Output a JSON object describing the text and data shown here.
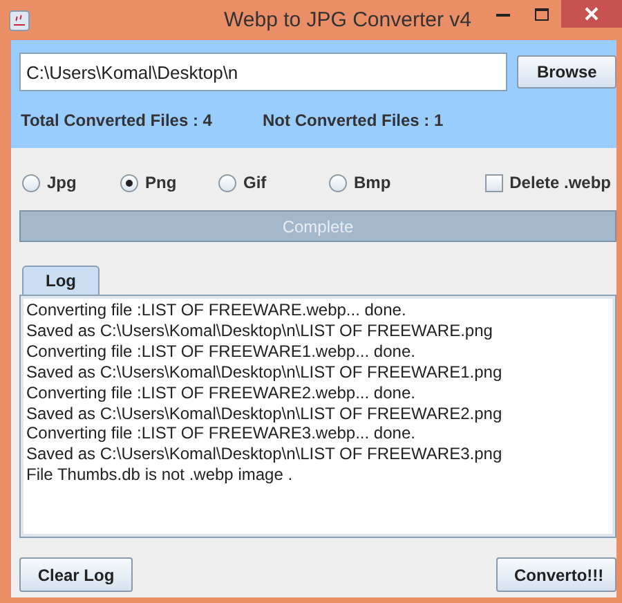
{
  "window": {
    "title": "Webp to JPG Converter v4"
  },
  "path_field": {
    "value": "C:\\Users\\Komal\\Desktop\\n"
  },
  "browse_button": "Browse",
  "stats": [
    {
      "label": "Total Converted Files : 4"
    },
    {
      "label": "Not Converted Files : 1"
    }
  ],
  "formats": [
    {
      "label": "Jpg",
      "selected": false
    },
    {
      "label": "Png",
      "selected": true
    },
    {
      "label": "Gif",
      "selected": false
    },
    {
      "label": "Bmp",
      "selected": false
    }
  ],
  "delete_webp": {
    "label": "Delete .webp",
    "checked": false
  },
  "progress": {
    "label": "Complete",
    "level": 1
  },
  "tabs": [
    {
      "label": "Log",
      "selected": true
    }
  ],
  "log": [
    "Converting file :LIST OF FREEWARE.webp... done.",
    "Saved as C:\\Users\\Komal\\Desktop\\n\\LIST OF FREEWARE.png",
    "Converting file :LIST OF FREEWARE1.webp... done.",
    "Saved as C:\\Users\\Komal\\Desktop\\n\\LIST OF FREEWARE1.png",
    "Converting file :LIST OF FREEWARE2.webp... done.",
    "Saved as C:\\Users\\Komal\\Desktop\\n\\LIST OF FREEWARE2.png",
    "Converting file :LIST OF FREEWARE3.webp... done.",
    "Saved as C:\\Users\\Komal\\Desktop\\n\\LIST OF FREEWARE3.png",
    "File Thumbs.db is not .webp image ."
  ],
  "buttons": [
    "Clear Log",
    "Converto!!!"
  ]
}
